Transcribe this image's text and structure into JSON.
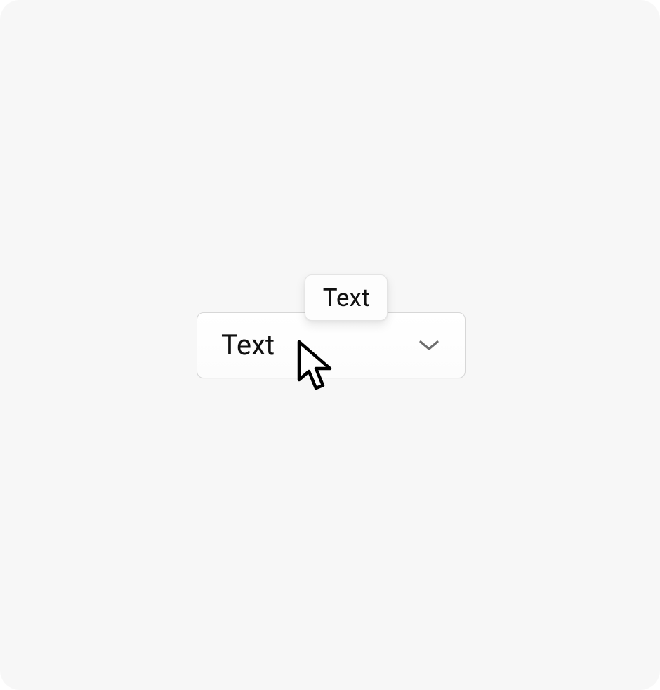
{
  "dropdown": {
    "value": "Text"
  },
  "tooltip": {
    "label": "Text"
  }
}
